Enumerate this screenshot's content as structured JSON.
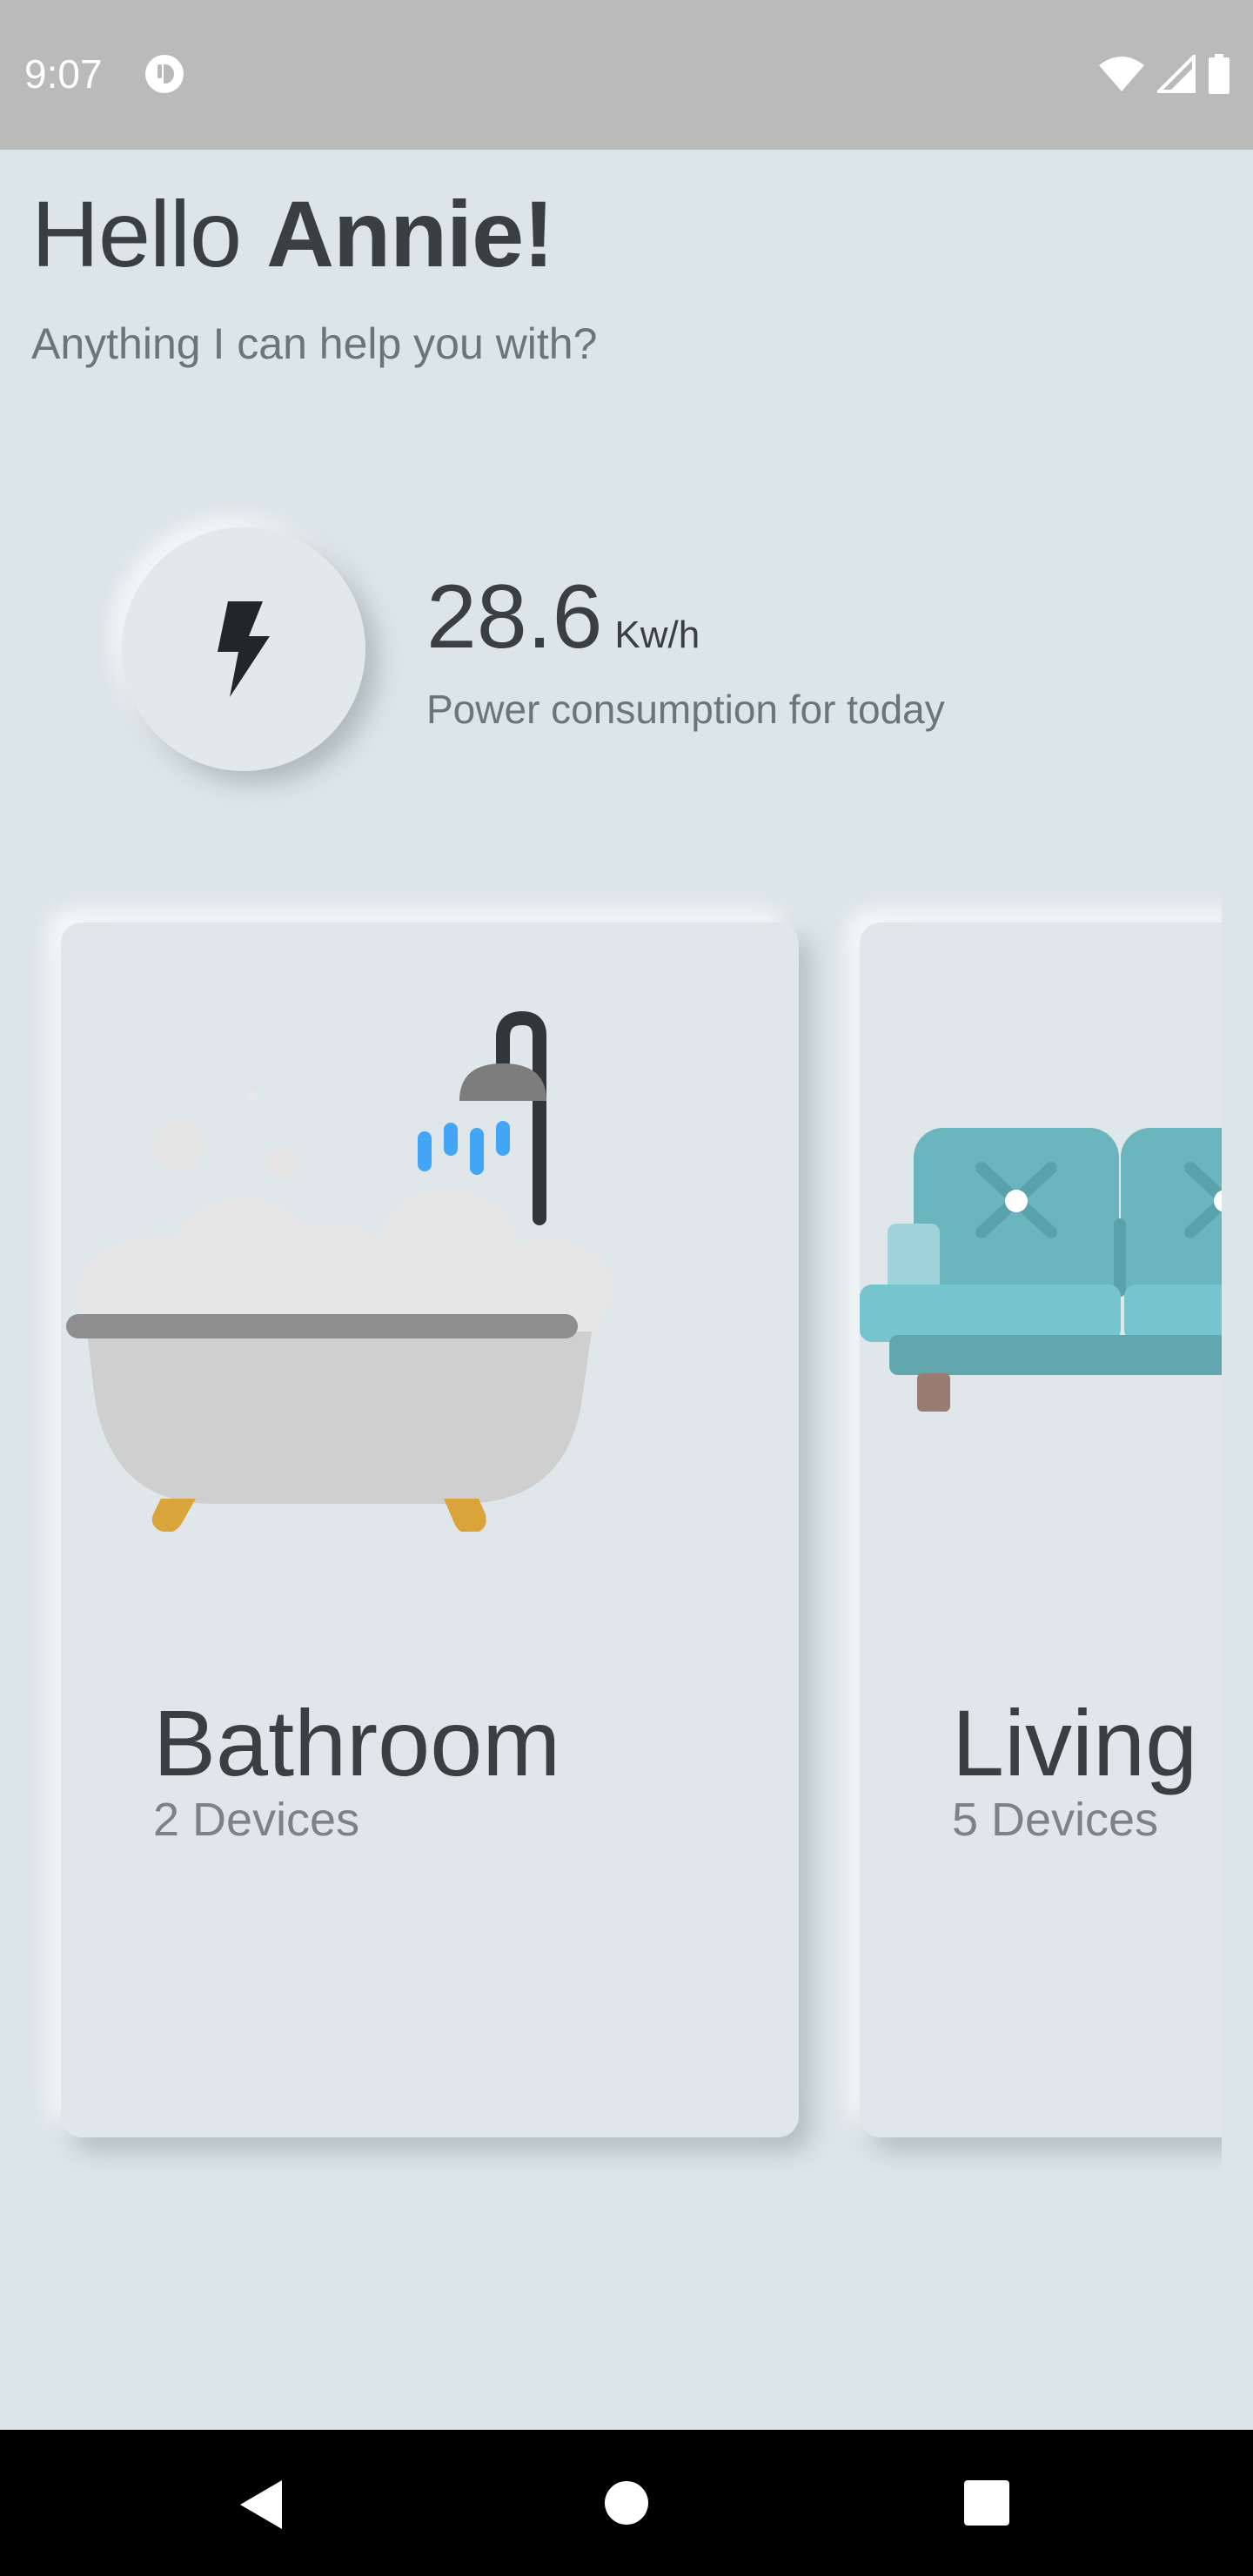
{
  "status_bar": {
    "time": "9:07",
    "icons": [
      "app-notification-icon",
      "wifi-icon",
      "signal-icon",
      "battery-icon"
    ]
  },
  "greeting": {
    "hello": "Hello ",
    "name": "Annie!",
    "subtitle": "Anything I can help you with?"
  },
  "power": {
    "icon": "lightning-bolt-icon",
    "value": "28.6",
    "unit": "Kw/h",
    "caption": "Power consumption for today"
  },
  "rooms": [
    {
      "name": "Bathroom",
      "devices": "2 Devices",
      "icon": "bathtub-shower-icon"
    },
    {
      "name": "Living Room",
      "devices": "5 Devices",
      "icon": "sofa-icon"
    }
  ],
  "nav_bar": {
    "buttons": [
      "back-icon",
      "home-icon",
      "recents-icon"
    ]
  },
  "colors": {
    "background": "#dce5e8",
    "status_bar": "#bababa",
    "card": "#e0e7ea",
    "text_primary": "#3a3f42",
    "text_secondary": "#6e7578",
    "shower_water": "#42a5f5",
    "sofa": "#6ab5be"
  }
}
